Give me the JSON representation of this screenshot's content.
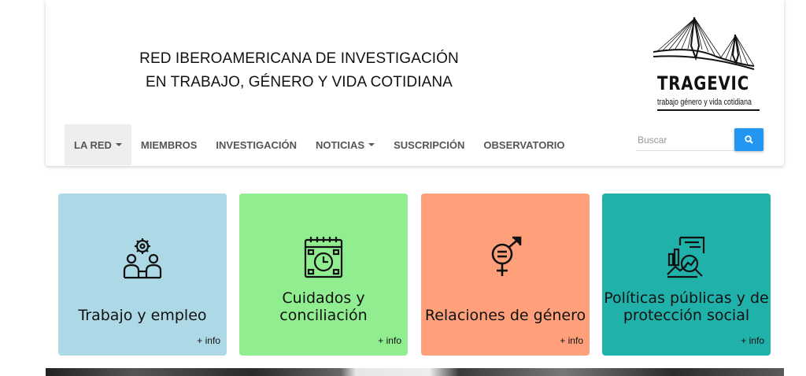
{
  "header": {
    "title_line1": "RED IBEROAMERICANA DE INVESTIGACIÓN",
    "title_line2": "EN TRABAJO, GÉNERO Y VIDA COTIDIANA",
    "logo_name": "TRAGEVIC",
    "logo_tagline": "trabajo género y vida cotidiana"
  },
  "nav": {
    "items": [
      {
        "label": "LA RED",
        "dropdown": true,
        "active": true
      },
      {
        "label": "MIEMBROS",
        "dropdown": false,
        "active": false
      },
      {
        "label": "INVESTIGACIÓN",
        "dropdown": false,
        "active": false
      },
      {
        "label": "NOTICIAS",
        "dropdown": true,
        "active": false
      },
      {
        "label": "SUSCRIPCIÓN",
        "dropdown": false,
        "active": false
      },
      {
        "label": "OBSERVATORIO",
        "dropdown": false,
        "active": false
      }
    ]
  },
  "search": {
    "placeholder": "Buscar",
    "value": "",
    "button_icon": "search-icon",
    "button_color": "#2196f3"
  },
  "cards": [
    {
      "title": "Trabajo y empleo",
      "more": "+ info",
      "color": "#add8e6",
      "icon": "workers-gear-icon"
    },
    {
      "title": "Cuidados y conciliación",
      "more": "+ info",
      "color": "#90ee90",
      "icon": "calendar-clock-icon"
    },
    {
      "title": "Relaciones de género",
      "more": "+ info",
      "color": "#ffa07a",
      "icon": "gender-symbol-icon"
    },
    {
      "title": "Políticas públicas y de protección social",
      "more": "+ info",
      "color": "#20b2aa",
      "icon": "policy-chart-icon"
    }
  ]
}
